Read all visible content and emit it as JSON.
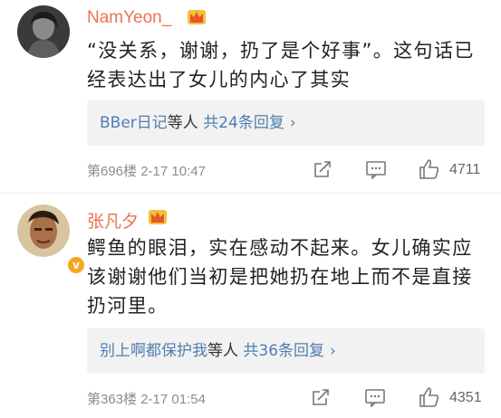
{
  "comments": [
    {
      "username": "NamYeon_",
      "text": "“没关系，谢谢，扔了是个好事”。这句话已经表达出了女儿的内心了其实",
      "reply_users": "BBer日记",
      "reply_mid": "等人",
      "reply_count": "共24条回复",
      "floor_time": "第696楼  2-17 10:47",
      "likes": "4711"
    },
    {
      "username": "张凡夕",
      "verified_badge": "v",
      "text": "鳄鱼的眼泪，实在感动不起来。女儿确实应该谢谢他们当初是把她扔在地上而不是直接扔河里。",
      "reply_users": "别上啊都保护我",
      "reply_mid": "等人",
      "reply_count": "共36条回复",
      "floor_time": "第363楼  2-17 01:54",
      "likes": "4351"
    }
  ],
  "colors": {
    "username": "#eb7350",
    "link": "#507daf",
    "meta": "#8c8c8c",
    "reply_bg": "#f2f2f2"
  },
  "icons": [
    "crown-icon",
    "share-icon",
    "comment-icon",
    "like-icon",
    "chevron-right-icon"
  ]
}
